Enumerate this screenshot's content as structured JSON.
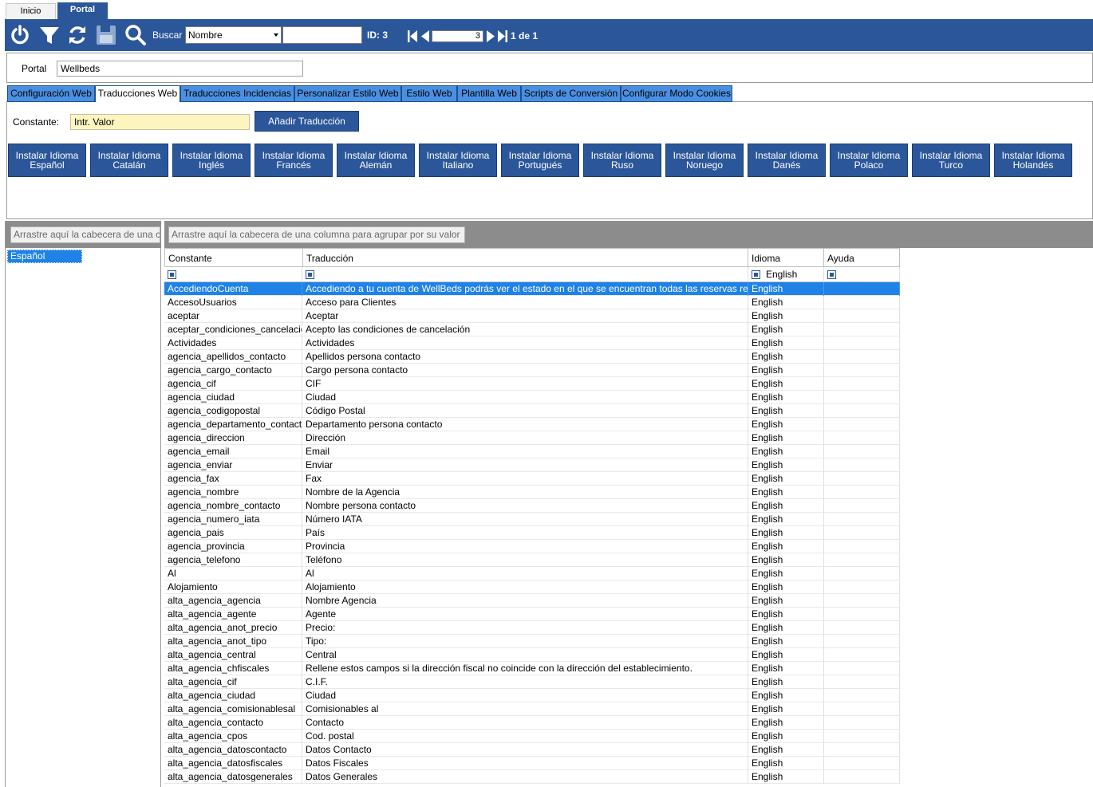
{
  "window_tabs": {
    "inicio": "Inicio",
    "portal": "Portal"
  },
  "toolbar": {
    "power_icon": "power-icon",
    "filter_icon": "filter-icon",
    "refresh_icon": "refresh-icon",
    "save_icon": "save-icon",
    "search_icon": "search-icon",
    "buscar_label": "Buscar",
    "search_field_value": "Nombre",
    "search_text": "",
    "id_label": "ID: 3",
    "page_value": "3",
    "page_count": "1 de 1"
  },
  "portal": {
    "label": "Portal",
    "value": "Wellbeds"
  },
  "tabs": [
    "Configuración Web",
    "Traducciones Web",
    "Traducciones Incidencias",
    "Personalizar Estilo Web",
    "Estilo Web",
    "Plantilla Web",
    "Scripts de Conversión",
    "Configurar Modo Cookies"
  ],
  "active_tab": "Traducciones Web",
  "constante": {
    "label": "Constante:",
    "placeholder": "Intr. Valor",
    "add_button": "Añadir Traducción"
  },
  "language_buttons": [
    [
      "Instalar Idioma",
      "Español"
    ],
    [
      "Instalar Idioma",
      "Catalán"
    ],
    [
      "Instalar Idioma",
      "Inglés"
    ],
    [
      "Instalar Idioma",
      "Francés"
    ],
    [
      "Instalar Idioma",
      "Alemán"
    ],
    [
      "Instalar Idioma",
      "Italiano"
    ],
    [
      "Instalar Idioma",
      "Portugués"
    ],
    [
      "Instalar Idioma",
      "Ruso"
    ],
    [
      "Instalar Idioma",
      "Noruego"
    ],
    [
      "Instalar Idioma",
      "Danés"
    ],
    [
      "Instalar Idioma",
      "Polaco"
    ],
    [
      "Instalar Idioma",
      "Turco"
    ],
    [
      "Instalar Idioma",
      "Holandés"
    ]
  ],
  "left_group_hint": "Arrastre aquí la cabecera de una columna para agrupar por su valor",
  "left_items": [
    "Español"
  ],
  "grid_group_hint": "Arrastre aquí la cabecera de una columna para agrupar por su valor",
  "columns": [
    "Constante",
    "Traducción",
    "Idioma",
    "Ayuda"
  ],
  "filter_idioma": "English",
  "rows": [
    [
      "AccediendoCuenta",
      "Accediendo a tu cuenta de WellBeds podrás ver el estado en el que se encuentran todas las reservas realizadas.",
      "English",
      ""
    ],
    [
      "AccesoUsuarios",
      "Acceso para Clientes",
      "English",
      ""
    ],
    [
      "aceptar",
      "Aceptar",
      "English",
      ""
    ],
    [
      "aceptar_condiciones_cancelacion",
      "Acepto las condiciones de cancelación",
      "English",
      ""
    ],
    [
      "Actividades",
      "Actividades",
      "English",
      ""
    ],
    [
      "agencia_apellidos_contacto",
      "Apellidos persona contacto",
      "English",
      ""
    ],
    [
      "agencia_cargo_contacto",
      "Cargo persona contacto",
      "English",
      ""
    ],
    [
      "agencia_cif",
      "CIF",
      "English",
      ""
    ],
    [
      "agencia_ciudad",
      "Ciudad",
      "English",
      ""
    ],
    [
      "agencia_codigopostal",
      "Código Postal",
      "English",
      ""
    ],
    [
      "agencia_departamento_contacto",
      "Departamento persona contacto",
      "English",
      ""
    ],
    [
      "agencia_direccion",
      "Dirección",
      "English",
      ""
    ],
    [
      "agencia_email",
      "Email",
      "English",
      ""
    ],
    [
      "agencia_enviar",
      "Enviar",
      "English",
      ""
    ],
    [
      "agencia_fax",
      "Fax",
      "English",
      ""
    ],
    [
      "agencia_nombre",
      "Nombre de la Agencia",
      "English",
      ""
    ],
    [
      "agencia_nombre_contacto",
      "Nombre persona contacto",
      "English",
      ""
    ],
    [
      "agencia_numero_iata",
      "Número IATA",
      "English",
      ""
    ],
    [
      "agencia_pais",
      "País",
      "English",
      ""
    ],
    [
      "agencia_provincia",
      "Provincia",
      "English",
      ""
    ],
    [
      "agencia_telefono",
      "Teléfono",
      "English",
      ""
    ],
    [
      "Al",
      "Al",
      "English",
      ""
    ],
    [
      "Alojamiento",
      "Alojamiento",
      "English",
      ""
    ],
    [
      "alta_agencia_agencia",
      "Nombre Agencia",
      "English",
      ""
    ],
    [
      "alta_agencia_agente",
      "Agente",
      "English",
      ""
    ],
    [
      "alta_agencia_anot_precio",
      "Precio:",
      "English",
      ""
    ],
    [
      "alta_agencia_anot_tipo",
      "Tipo:",
      "English",
      ""
    ],
    [
      "alta_agencia_central",
      "Central",
      "English",
      ""
    ],
    [
      "alta_agencia_chfiscales",
      "Rellene estos campos si la dirección fiscal no coincide con la dirección del establecimiento.",
      "English",
      ""
    ],
    [
      "alta_agencia_cif",
      "C.I.F.",
      "English",
      ""
    ],
    [
      "alta_agencia_ciudad",
      "Ciudad",
      "English",
      ""
    ],
    [
      "alta_agencia_comisionablesal",
      "Comisionables al",
      "English",
      ""
    ],
    [
      "alta_agencia_contacto",
      "Contacto",
      "English",
      ""
    ],
    [
      "alta_agencia_cpos",
      "Cod. postal",
      "English",
      ""
    ],
    [
      "alta_agencia_datoscontacto",
      "Datos Contacto",
      "English",
      ""
    ],
    [
      "alta_agencia_datosfiscales",
      "Datos Fiscales",
      "English",
      ""
    ],
    [
      "alta_agencia_datosgenerales",
      "Datos Generales",
      "English",
      ""
    ]
  ],
  "selected_row": 0
}
